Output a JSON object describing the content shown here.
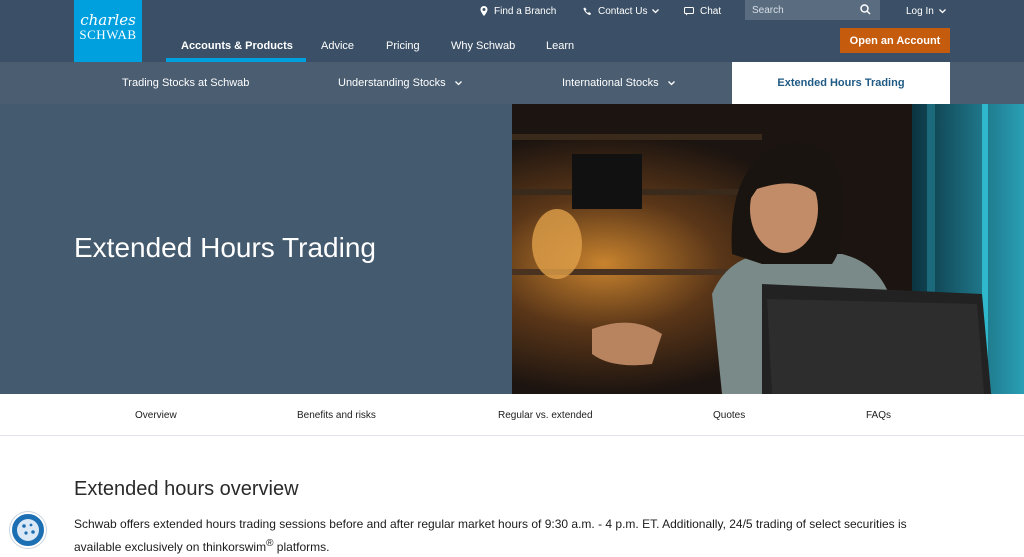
{
  "brand": {
    "line1": "charles",
    "line2": "SCHWAB"
  },
  "utility": {
    "find_branch": "Find a Branch",
    "contact_us": "Contact Us",
    "chat": "Chat",
    "search_placeholder": "Search",
    "login": "Log In"
  },
  "main_nav": {
    "items": [
      "Accounts & Products",
      "Advice",
      "Pricing",
      "Why Schwab",
      "Learn"
    ],
    "active": "Accounts & Products"
  },
  "cta": {
    "open_account": "Open an Account"
  },
  "sub_nav": {
    "items": [
      {
        "label": "Trading Stocks at Schwab"
      },
      {
        "label": "Understanding Stocks"
      },
      {
        "label": "International Stocks"
      },
      {
        "label": "Extended Hours Trading"
      }
    ]
  },
  "hero": {
    "title": "Extended Hours Trading"
  },
  "page_nav": [
    "Overview",
    "Benefits and risks",
    "Regular vs. extended",
    "Quotes",
    "FAQs"
  ],
  "content": {
    "heading": "Extended hours overview",
    "body_part1": "Schwab offers extended hours trading sessions before and after regular market hours of 9:30 a.m. - 4 p.m. ET. Additionally, 24/5 trading of select securities is available exclusively on thinkorswim",
    "body_sup": "®",
    "body_part2": " platforms."
  },
  "colors": {
    "header_bg": "#3b5066",
    "subnav_bg": "#4a5d71",
    "hero_bg": "#445a6e",
    "logo_bg": "#00a0df",
    "cta_bg": "#c45b0d",
    "active_link": "#1f5a84"
  },
  "icons": [
    "location-pin-icon",
    "phone-icon",
    "chat-bubble-icon",
    "search-icon",
    "chevron-down-icon",
    "cookie-icon"
  ]
}
